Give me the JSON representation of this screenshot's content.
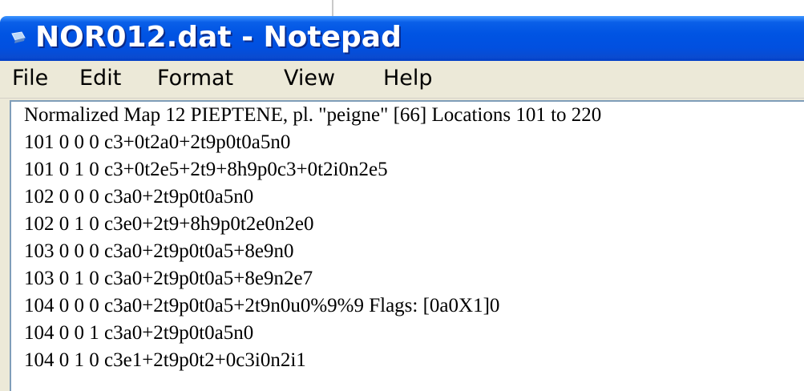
{
  "window": {
    "title": "NOR012.dat - Notepad",
    "icon": "notepad-icon"
  },
  "menu": [
    "File",
    "Edit",
    "Format",
    "View",
    "Help"
  ],
  "document": {
    "lines": [
      "Normalized Map 12 PIEPTENE, pl. \"peigne\" [66] Locations 101 to 220",
      "101 0 0 0 c3+0t2a0+2t9p0t0a5n0",
      "101 0 1 0 c3+0t2e5+2t9+8h9p0c3+0t2i0n2e5",
      "102 0 0 0 c3a0+2t9p0t0a5n0",
      "102 0 1 0 c3e0+2t9+8h9p0t2e0n2e0",
      "103 0 0 0 c3a0+2t9p0t0a5+8e9n0",
      "103 0 1 0 c3a0+2t9p0t0a5+8e9n2e7",
      "104 0 0 0 c3a0+2t9p0t0a5+2t9n0u0%9%9 Flags: [0a0X1]0",
      "104 0 0 1 c3a0+2t9p0t0a5n0",
      "104 0 1 0 c3e1+2t9p0t2+0c3i0n2i1"
    ]
  },
  "colors": {
    "titlebar": "#0054e3",
    "title_text": "#ffffff",
    "menubar": "#ece9d8",
    "edit_background": "#ffffff",
    "edit_border": "#7f9db9"
  }
}
